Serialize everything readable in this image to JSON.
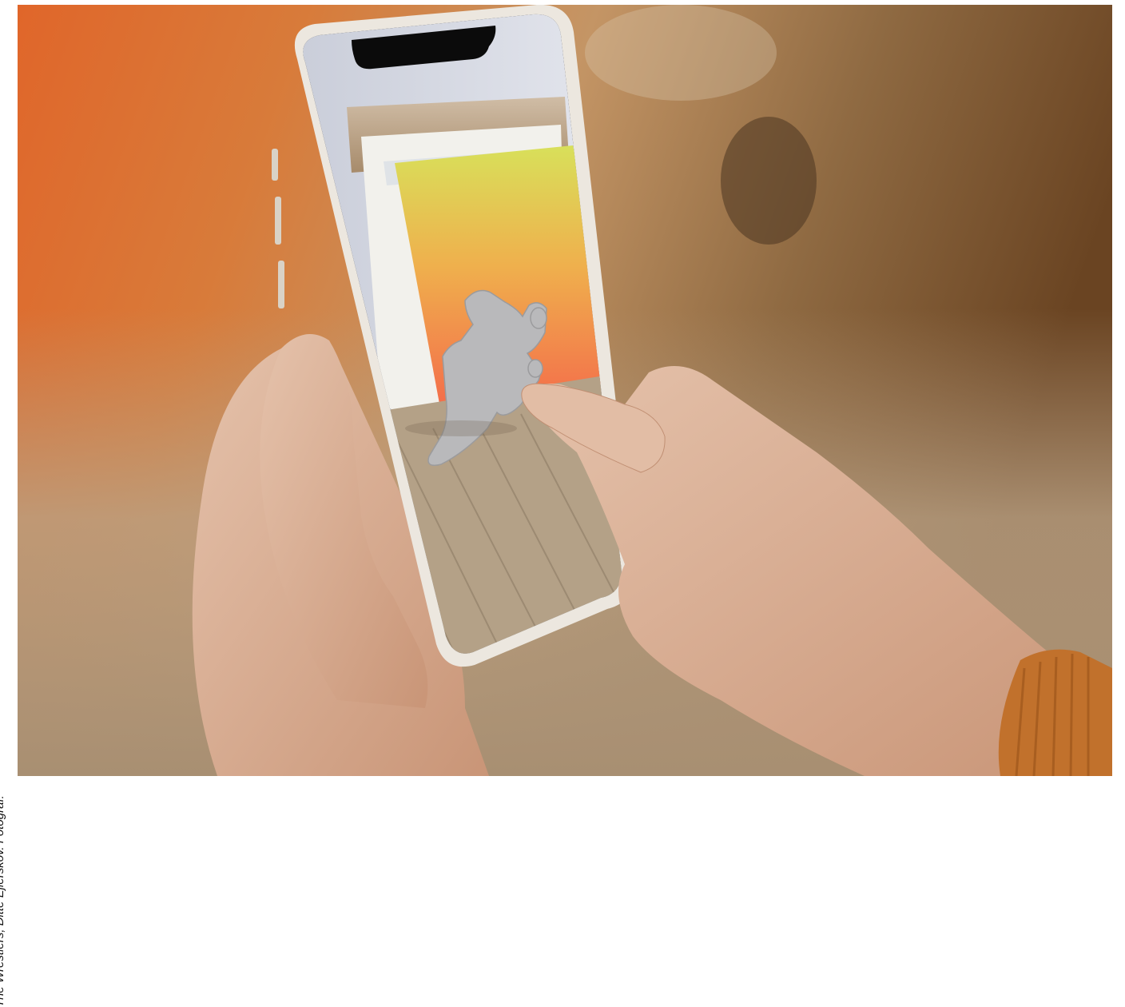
{
  "caption": {
    "text": "The Wrestlers, Ditte Ejlerskov. Fotograf:"
  },
  "photo": {
    "subject": "hands-holding-smartphone-showing-ar-sculpture",
    "palette": {
      "background_orange": "#d56a2c",
      "background_brown": "#9a6a3d",
      "floor_wood": "#b9a58a",
      "skin": "#dcb39a",
      "sleeve": "#c1712c",
      "sculpture_grey": "#b9b9bb"
    }
  }
}
